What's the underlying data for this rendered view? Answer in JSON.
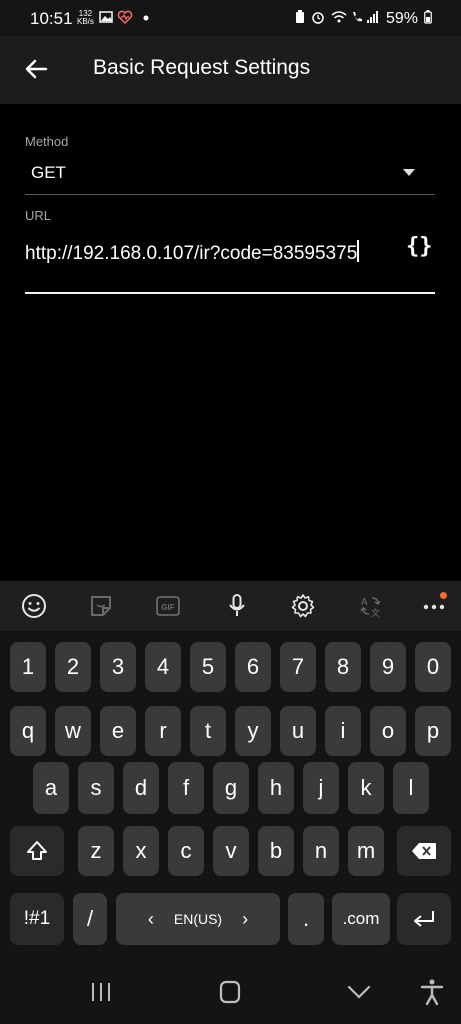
{
  "status": {
    "time": "10:51",
    "speed_top": "132",
    "speed_unit": "KB/s",
    "battery": "59%"
  },
  "appbar": {
    "title": "Basic Request Settings"
  },
  "form": {
    "method_label": "Method",
    "method_value": "GET",
    "url_label": "URL",
    "url_value": "http://192.168.0.107/ir?code=83595375",
    "variables_button": "{}"
  },
  "keyboard": {
    "toolbar_icons": [
      "emoji-icon",
      "sticker-icon",
      "gif-icon",
      "microphone-icon",
      "settings-gear-icon",
      "translate-icon",
      "more-options-icon"
    ],
    "row_numbers": [
      "1",
      "2",
      "3",
      "4",
      "5",
      "6",
      "7",
      "8",
      "9",
      "0"
    ],
    "row_1": [
      "q",
      "w",
      "e",
      "r",
      "t",
      "y",
      "u",
      "i",
      "o",
      "p"
    ],
    "row_2": [
      "a",
      "s",
      "d",
      "f",
      "g",
      "h",
      "j",
      "k",
      "l"
    ],
    "row_3": [
      "z",
      "x",
      "c",
      "v",
      "b",
      "n",
      "m"
    ],
    "symbols_key": "!#1",
    "slash_key": "/",
    "space_language": "EN(US)",
    "period_key": ".",
    "dotcom_key": ".com"
  },
  "colors": {
    "background": "#000000",
    "app_bar": "#1c1c1c",
    "key": "#3a3a3a",
    "notification_dot": "#ff6d2e"
  }
}
